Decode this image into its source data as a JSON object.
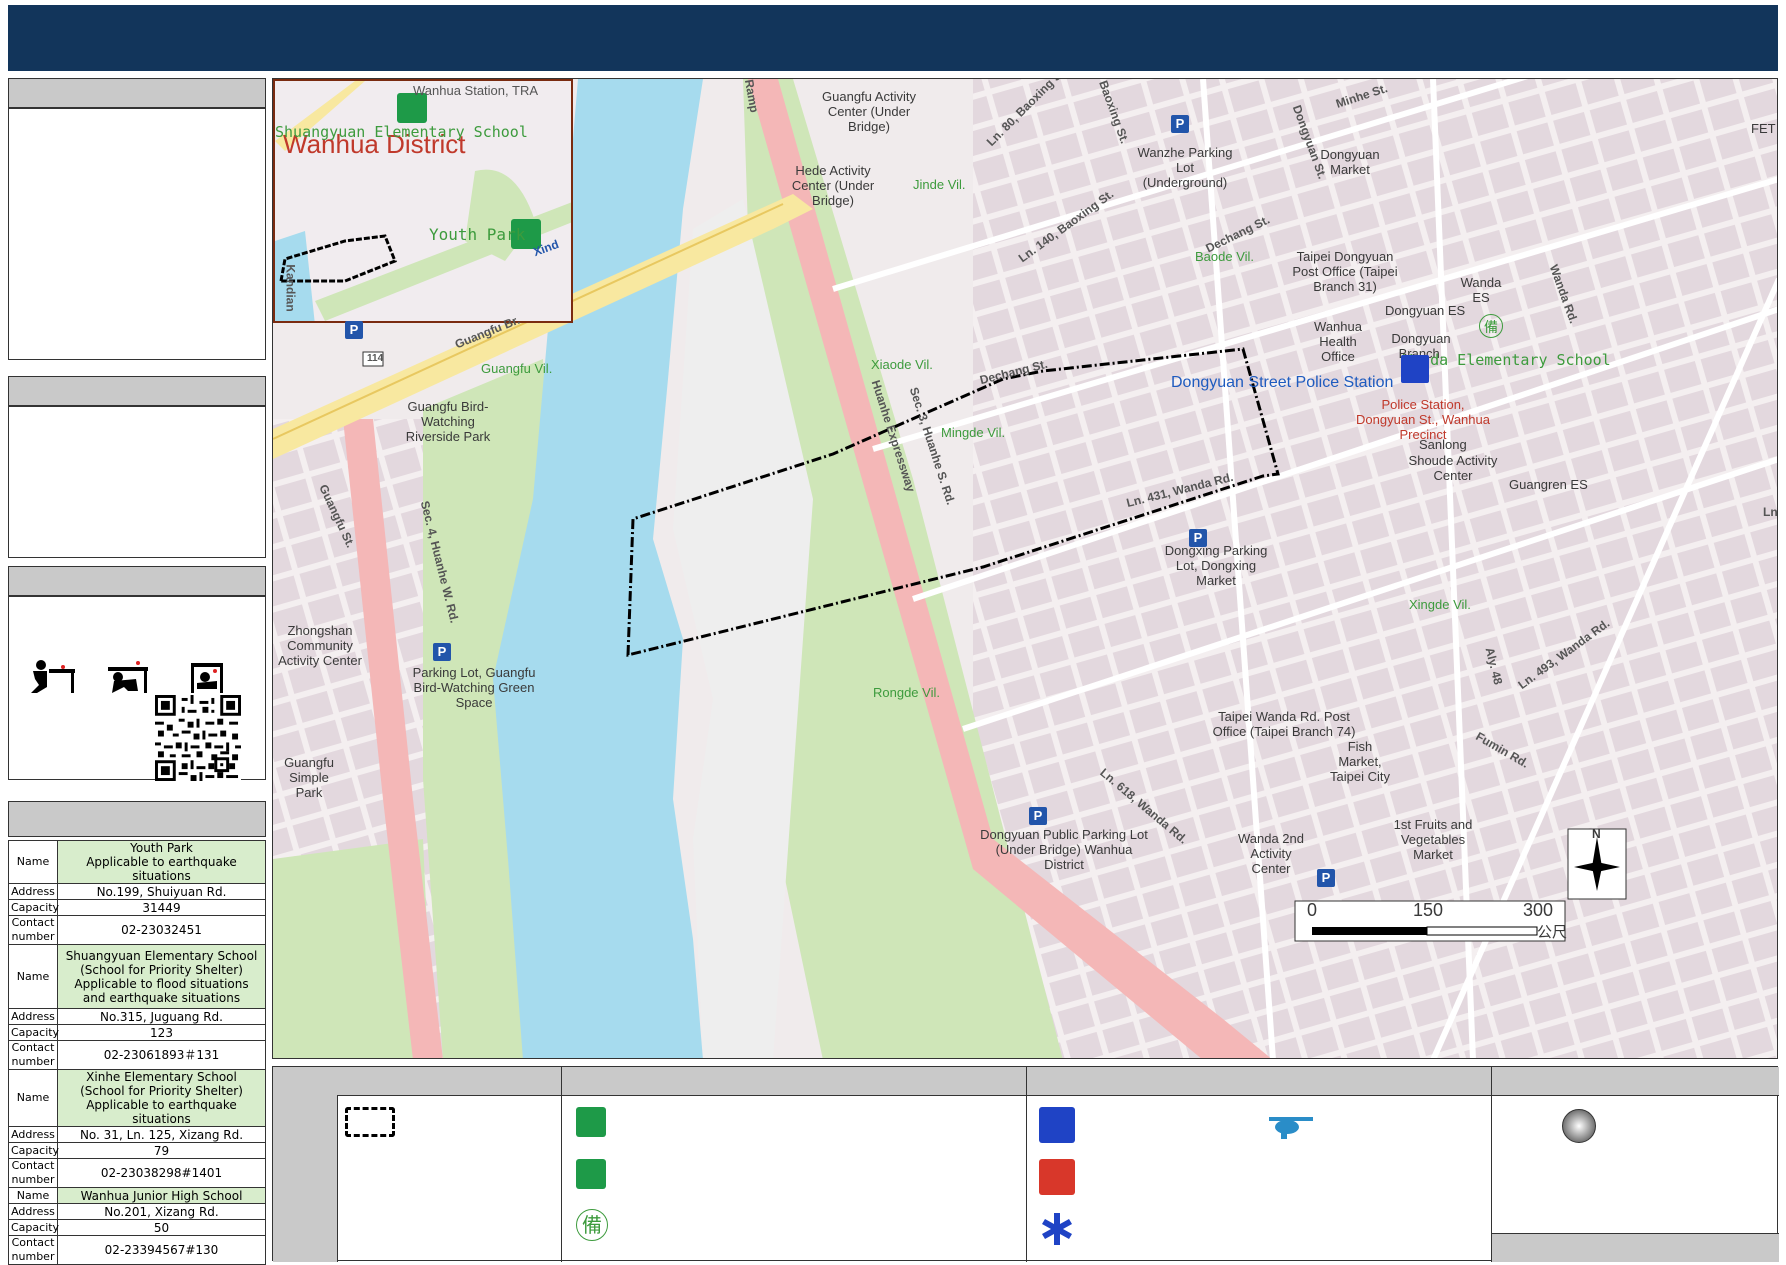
{
  "map": {
    "inset_labels": {
      "district": "Wanhua District",
      "station": "Wanhua Station, TRA",
      "shuangyuan": "Shuangyuan Elementary School",
      "youth_park": "Youth Park",
      "xind": "Xind",
      "kandian": "Kandian"
    },
    "labels": {
      "guangfu_activity": "Guangfu Activity Center (Under Bridge)",
      "hede_activity": "Hede Activity Center (Under Bridge)",
      "jinde": "Jinde Vil.",
      "wanzhe_parking": "Wanzhe Parking Lot (Underground)",
      "dongyuan_market": "Dongyuan Market",
      "baode": "Baode Vil.",
      "post_office": "Taipei Dongyuan Post Office (Taipei Branch 31)",
      "wanda_es": "Wanda ES",
      "dongyuan_es": "Dongyuan ES",
      "health_office": "Wanhua Health Office",
      "dongyuan_branch": "Dongyuan Branch, Taipei Public Library",
      "wanda_elementary": "Wanda Elementary School",
      "police_station": "Dongyuan Street Police Station",
      "police_station_small": "Police Station, Dongyuan St., Wanhua Precinct",
      "sanlong": "Sanlong",
      "shoude": "Shoude Activity Center",
      "guangren": "Guangren ES",
      "xiaode": "Xiaode Vil.",
      "mingde": "Mingde Vil.",
      "guangfu_vil": "Guangfu Vil.",
      "birdwatching_park": "Guangfu Bird-Watching Riverside Park",
      "dongxing_parking": "Dongxing Parking Lot, Dongxing Market",
      "xingde": "Xingde Vil.",
      "zhongshan": "Zhongshan Community Activity Center",
      "parking_greenspace": "Parking Lot, Guangfu Bird-Watching Green Space",
      "rongde": "Rongde Vil.",
      "guangfu_simple": "Guangfu Simple Park",
      "wanda_post": "Taipei Wanda Rd. Post Office (Taipei Branch 74)",
      "fish_market": "Fish Market, Taipei City",
      "dongyuan_public_parking": "Dongyuan Public Parking Lot (Under Bridge) Wanhua District",
      "wanda2": "Wanda 2nd Activity Center",
      "fruits_market": "1st Fruits and Vegetables Market",
      "fet": "FET"
    },
    "roads": {
      "guangfu_br": "Guangfu Br.",
      "minhe": "Minhe St.",
      "ln80": "Ln. 80, Baoxing St.",
      "baoxing": "Baoxing St.",
      "dongyuan_st": "Dongyuan St.",
      "dechang": "Dechang St.",
      "ln140": "Ln. 140, Baoxing St.",
      "wanda_rd": "Wanda Rd.",
      "dechang2": "Dechang St.",
      "huanhe_exp": "Huanhe Expressway",
      "huanhe_s": "Sec. 3, Huanhe S. Rd.",
      "huanhe_w": "Sec. 4, Huanhe W. Rd.",
      "guangfu_st": "Guangfu St.",
      "ramp": "Ramp",
      "ln431": "Ln. 431, Wanda Rd.",
      "ln618": "Ln. 618, Wanda Rd.",
      "ln493": "Ln. 493, Wanda Rd.",
      "aly48": "Aly. 48",
      "fumin": "Fumin Rd.",
      "ln": "Ln.",
      "hwy114": "114",
      "kanji": "備"
    },
    "scale": {
      "zero": "0",
      "mid": "150",
      "max": "300",
      "unit": "公尺"
    },
    "north": "N"
  },
  "shelters": [
    {
      "name": "Youth Park\nApplicable to earthquake situations",
      "address": "No.199, Shuiyuan Rd.",
      "capacity": "31449",
      "contact": "02-23032451"
    },
    {
      "name": "Shuangyuan Elementary School\n(School for Priority Shelter)\nApplicable to flood situations\nand earthquake situations",
      "address": "No.315, Juguang Rd.",
      "capacity": "123",
      "contact": "02-23061893＃131"
    },
    {
      "name": "Xinhe Elementary School\n(School for Priority Shelter)\nApplicable to earthquake situations",
      "address": "No. 31, Ln. 125, Xizang Rd.",
      "capacity": "79",
      "contact": "02-23038298#1401"
    },
    {
      "name": "Wanhua Junior High School",
      "address": "No.201, Xizang Rd.",
      "capacity": "50",
      "contact": "02-23394567#130"
    }
  ],
  "shelter_labels": {
    "name": "Name",
    "address": "Address",
    "capacity": "Capacity",
    "contact": "Contact number"
  },
  "colors": {
    "banner": "#12355b",
    "river": "#a6dbee",
    "green": "#cfe6b8",
    "road": "#f4b7b7",
    "boundary": "#000000"
  }
}
